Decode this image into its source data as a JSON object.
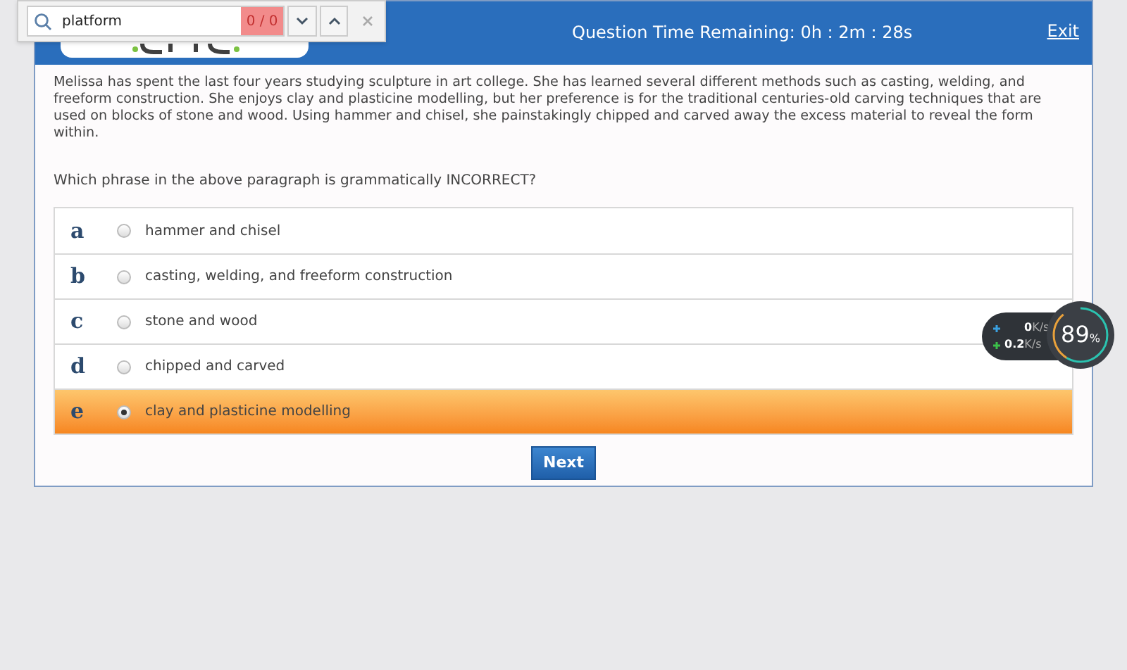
{
  "find_bar": {
    "value": "platform",
    "count": "0 / 0"
  },
  "header": {
    "timer": "Question Time Remaining: 0h : 2m : 28s",
    "exit": "Exit"
  },
  "passage": "Melissa has spent the last four years studying sculpture in art college. She has learned several different methods such as casting, welding, and freeform construction. She enjoys clay and plasticine modelling, but her preference is for the traditional centuries-old carving techniques that are used on blocks of stone and wood. Using hammer and chisel, she painstakingly chipped and carved away the excess material to reveal the form within.",
  "question": "Which phrase in the above paragraph is grammatically INCORRECT?",
  "options": [
    {
      "letter": "a",
      "text": "hammer and chisel",
      "selected": false
    },
    {
      "letter": "b",
      "text": "casting, welding, and freeform construction",
      "selected": false
    },
    {
      "letter": "c",
      "text": "stone and wood",
      "selected": false
    },
    {
      "letter": "d",
      "text": "chipped and carved",
      "selected": false
    },
    {
      "letter": "e",
      "text": "clay and plasticine modelling",
      "selected": true
    }
  ],
  "next_button": "Next",
  "speed_widget": {
    "upload": "0",
    "upload_unit": "K/s",
    "download": "0.2",
    "download_unit": "K/s",
    "percent": "89",
    "percent_sign": "%"
  }
}
